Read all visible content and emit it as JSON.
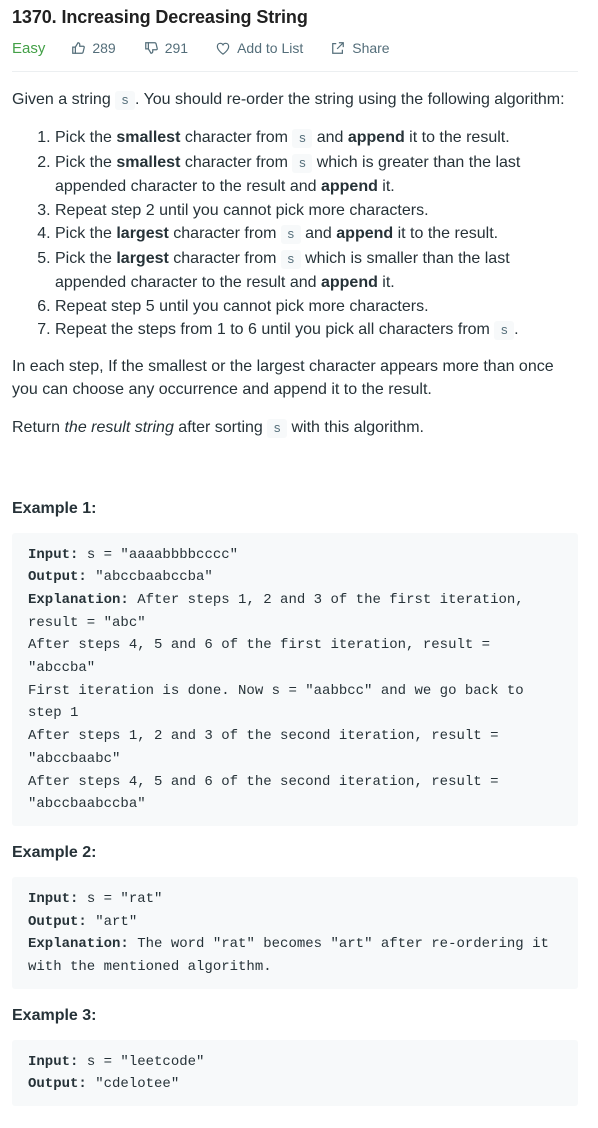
{
  "problem": {
    "title": "1370. Increasing Decreasing String",
    "difficulty": "Easy",
    "likes": "289",
    "dislikes": "291",
    "add_to_list": "Add to List",
    "share": "Share"
  },
  "description": {
    "intro_before": "Given a string ",
    "intro_code": "s",
    "intro_after": ". You should re-order the string using the following algorithm:",
    "steps": [
      {
        "a": "Pick the ",
        "b": "smallest",
        "c": " character from ",
        "code": "s",
        "d": " and ",
        "e": "append",
        "f": " it to the result."
      },
      {
        "a": "Pick the ",
        "b": "smallest",
        "c": " character from ",
        "code": "s",
        "d": " which is greater than the last appended character to the result and ",
        "e": "append",
        "f": " it."
      },
      {
        "text": "Repeat step 2 until you cannot pick more characters."
      },
      {
        "a": "Pick the ",
        "b": "largest",
        "c": " character from ",
        "code": "s",
        "d": " and ",
        "e": "append",
        "f": " it to the result."
      },
      {
        "a": "Pick the ",
        "b": "largest",
        "c": " character from ",
        "code": "s",
        "d": " which is smaller than the last appended character to the result and ",
        "e": "append",
        "f": " it."
      },
      {
        "text": "Repeat step 5 until you cannot pick more characters."
      },
      {
        "a": "Repeat the steps from 1 to 6 until you pick all characters from ",
        "code": "s",
        "f": "."
      }
    ],
    "para1": "In each step, If the smallest or the largest character appears more than once you can choose any occurrence and append it to the result.",
    "return_before": "Return ",
    "return_em": "the result string",
    "return_mid": " after sorting ",
    "return_code": "s",
    "return_after": " with this algorithm."
  },
  "examples": [
    {
      "title": "Example 1:",
      "input_label": "Input:",
      "input": " s = \"aaaabbbbcccc\"",
      "output_label": "Output:",
      "output": " \"abccbaabccba\"",
      "explanation_label": "Explanation:",
      "explanation": " After steps 1, 2 and 3 of the first iteration, result = \"abc\"\nAfter steps 4, 5 and 6 of the first iteration, result = \"abccba\"\nFirst iteration is done. Now s = \"aabbcc\" and we go back to step 1\nAfter steps 1, 2 and 3 of the second iteration, result = \"abccbaabc\"\nAfter steps 4, 5 and 6 of the second iteration, result = \"abccbaabccba\""
    },
    {
      "title": "Example 2:",
      "input_label": "Input:",
      "input": " s = \"rat\"",
      "output_label": "Output:",
      "output": " \"art\"",
      "explanation_label": "Explanation:",
      "explanation": " The word \"rat\" becomes \"art\" after re-ordering it with the mentioned algorithm."
    },
    {
      "title": "Example 3:",
      "input_label": "Input:",
      "input": " s = \"leetcode\"",
      "output_label": "Output:",
      "output": " \"cdelotee\""
    }
  ],
  "colors": {
    "easy": "#43a047",
    "meta": "#546e7a",
    "text": "#263238",
    "code_bg": "#f7f9fa"
  }
}
